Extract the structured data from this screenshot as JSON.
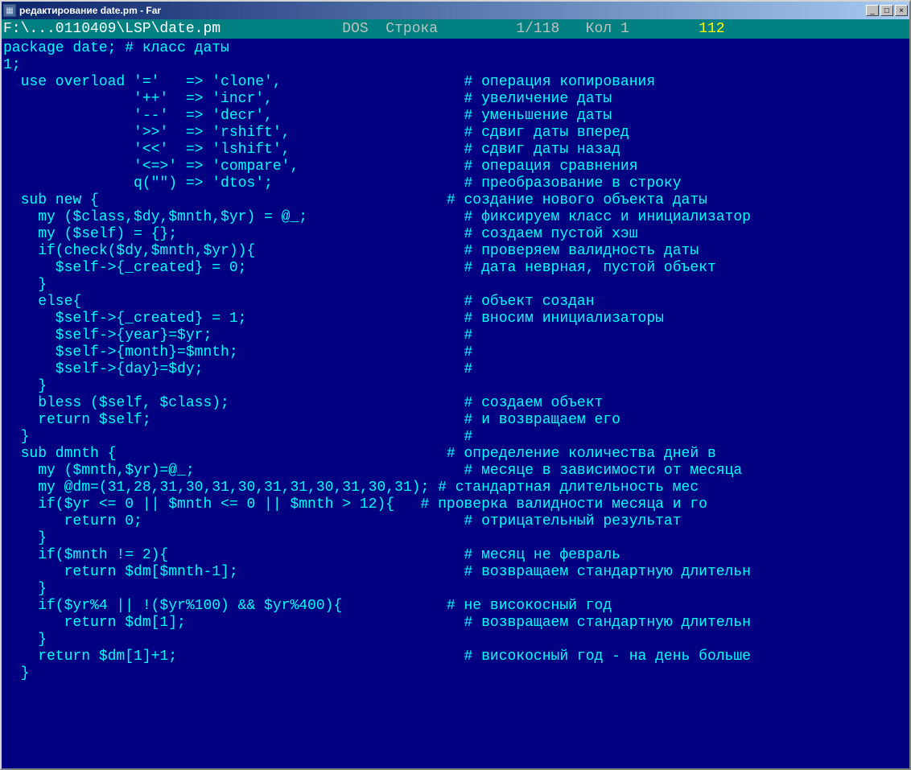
{
  "window": {
    "title": "редактирование date.pm - Far",
    "icon": "far-icon",
    "buttons": {
      "minimize": "_",
      "maximize": "□",
      "close": "×"
    }
  },
  "statusbar": {
    "path": "F:\\...0110409\\LSP\\date.pm",
    "encoding": "DOS",
    "line_label": "Строка",
    "line": "1/118",
    "col_label": "Кол",
    "col": "1",
    "total": "112"
  },
  "lines": [
    "package date; # класс даты",
    "1;",
    "  use overload '='   => 'clone',                     # операция копирования",
    "               '++'  => 'incr',                      # увеличение даты",
    "               '--'  => 'decr',                      # уменьшение даты",
    "               '>>'  => 'rshift',                    # сдвиг даты вперед",
    "               '<<'  => 'lshift',                    # сдвиг даты назад",
    "               '<=>' => 'compare',                   # операция сравнения",
    "               q(\"\") => 'dtos';                      # преобразование в строку",
    "  sub new {                                        # создание нового объекта даты",
    "    my ($class,$dy,$mnth,$yr) = @_;                  # фиксируем класс и инициализатор",
    "    my ($self) = {};                                 # создаем пустой хэш",
    "    if(check($dy,$mnth,$yr)){                        # проверяем валидность даты",
    "      $self->{_created} = 0;                         # дата неврная, пустой объект",
    "    }",
    "    else{                                            # объект создан",
    "      $self->{_created} = 1;                         # вносим инициализаторы",
    "      $self->{year}=$yr;                             #",
    "      $self->{month}=$mnth;                          #",
    "      $self->{day}=$dy;                              #",
    "    }",
    "    bless ($self, $class);                           # создаем объект",
    "    return $self;                                    # и возвращаем его",
    "  }                                                  #",
    "  sub dmnth {                                      # определение количества дней в",
    "    my ($mnth,$yr)=@_;                               # месяце в зависимости от месяца",
    "    my @dm=(31,28,31,30,31,30,31,31,30,31,30,31); # стандартная длительность мес",
    "    if($yr <= 0 || $mnth <= 0 || $mnth > 12){   # проверка валидности месяца и го",
    "       return 0;                                     # отрицательный результат",
    "    }",
    "    if($mnth != 2){                                  # месяц не февраль",
    "       return $dm[$mnth-1];                          # возвращаем стандартную длительн",
    "    }",
    "    if($yr%4 || !($yr%100) && $yr%400){            # не високосный год",
    "       return $dm[1];                                # возвращаем стандартную длительн",
    "    }",
    "    return $dm[1]+1;                                 # високосный год - на день больше",
    "  }"
  ]
}
